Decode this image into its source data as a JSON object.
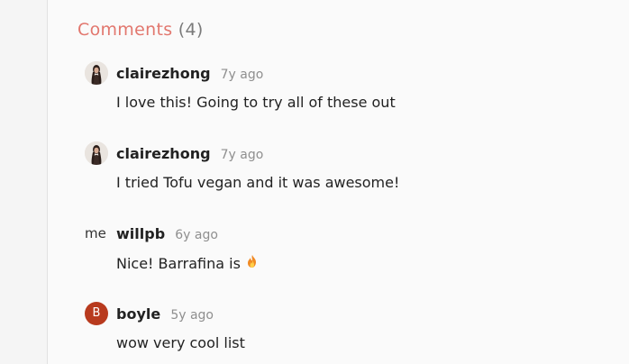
{
  "comments_header": {
    "title": "Comments",
    "count": "(4)"
  },
  "comments": [
    {
      "author": "clairezhong",
      "time": "7y ago",
      "text": "I love this! Going to try all of these out",
      "avatar": "photo"
    },
    {
      "author": "clairezhong",
      "time": "7y ago",
      "text": "I tried Tofu vegan and it was awesome!",
      "avatar": "photo"
    },
    {
      "author": "willpb",
      "time": "6y ago",
      "text": "Nice! Barrafina is",
      "avatar_text": "me",
      "emoji": "fire-icon"
    },
    {
      "author": "boyle",
      "time": "5y ago",
      "text": "wow very cool list",
      "avatar_letter": "B"
    }
  ],
  "colors": {
    "accent": "#e2776e",
    "avatar_b": "#b83a1e",
    "muted": "#8f8f8f"
  }
}
